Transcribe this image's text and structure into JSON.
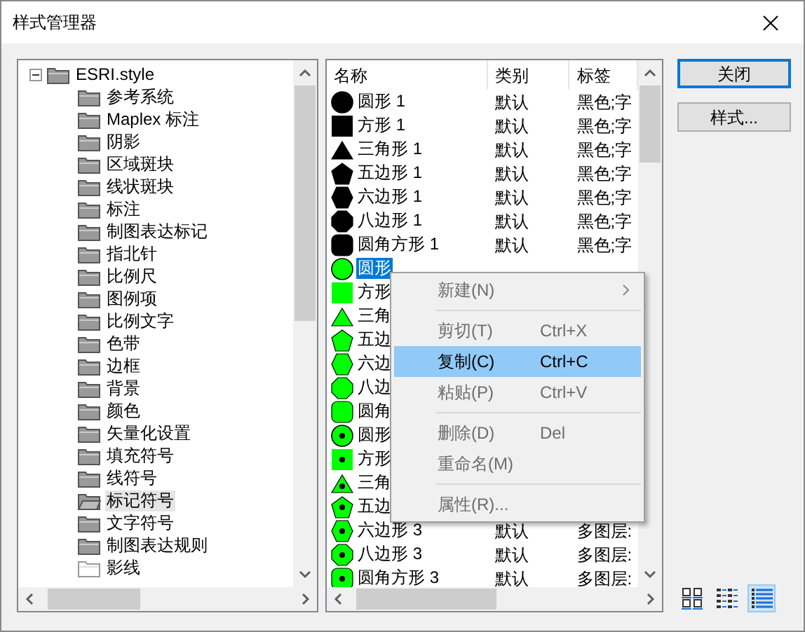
{
  "window": {
    "title": "样式管理器"
  },
  "tree": {
    "items": [
      {
        "label": "ESRI.style",
        "expanded": true,
        "children": [
          {
            "label": "参考系统",
            "selected": false,
            "empty": false
          },
          {
            "label": "Maplex 标注",
            "selected": false,
            "empty": false
          },
          {
            "label": "阴影",
            "selected": false,
            "empty": false
          },
          {
            "label": "区域斑块",
            "selected": false,
            "empty": false
          },
          {
            "label": "线状斑块",
            "selected": false,
            "empty": false
          },
          {
            "label": "标注",
            "selected": false,
            "empty": false
          },
          {
            "label": "制图表达标记",
            "selected": false,
            "empty": false
          },
          {
            "label": "指北针",
            "selected": false,
            "empty": false
          },
          {
            "label": "比例尺",
            "selected": false,
            "empty": false
          },
          {
            "label": "图例项",
            "selected": false,
            "empty": false
          },
          {
            "label": "比例文字",
            "selected": false,
            "empty": false
          },
          {
            "label": "色带",
            "selected": false,
            "empty": false
          },
          {
            "label": "边框",
            "selected": false,
            "empty": false
          },
          {
            "label": "背景",
            "selected": false,
            "empty": false
          },
          {
            "label": "颜色",
            "selected": false,
            "empty": false
          },
          {
            "label": "矢量化设置",
            "selected": false,
            "empty": false
          },
          {
            "label": "填充符号",
            "selected": false,
            "empty": false
          },
          {
            "label": "线符号",
            "selected": false,
            "empty": false
          },
          {
            "label": "标记符号",
            "selected": true,
            "empty": false
          },
          {
            "label": "文字符号",
            "selected": false,
            "empty": false
          },
          {
            "label": "制图表达规则",
            "selected": false,
            "empty": false
          },
          {
            "label": "影线",
            "selected": false,
            "empty": true
          }
        ]
      }
    ]
  },
  "table": {
    "columns": [
      "名称",
      "类别",
      "标签"
    ],
    "rows": [
      {
        "kind": "circle",
        "color": "#000000",
        "dot": false,
        "selected": false,
        "name": "圆形 1",
        "category": "默认",
        "tag": "黑色;字"
      },
      {
        "kind": "square",
        "color": "#000000",
        "dot": false,
        "selected": false,
        "name": "方形 1",
        "category": "默认",
        "tag": "黑色;字"
      },
      {
        "kind": "triangle",
        "color": "#000000",
        "dot": false,
        "selected": false,
        "name": "三角形 1",
        "category": "默认",
        "tag": "黑色;字"
      },
      {
        "kind": "pentagon",
        "color": "#000000",
        "dot": false,
        "selected": false,
        "name": "五边形 1",
        "category": "默认",
        "tag": "黑色;字"
      },
      {
        "kind": "hexagon",
        "color": "#000000",
        "dot": false,
        "selected": false,
        "name": "六边形 1",
        "category": "默认",
        "tag": "黑色;字"
      },
      {
        "kind": "octagon",
        "color": "#000000",
        "dot": false,
        "selected": false,
        "name": "八边形 1",
        "category": "默认",
        "tag": "黑色;字"
      },
      {
        "kind": "rounded",
        "color": "#000000",
        "dot": false,
        "selected": false,
        "name": "圆角方形 1",
        "category": "默认",
        "tag": "黑色;字"
      },
      {
        "kind": "circle",
        "color": "#00ff00",
        "dot": false,
        "selected": true,
        "name": "圆形"
      },
      {
        "kind": "square",
        "color": "#00ff00",
        "dot": false,
        "selected": false,
        "name": "方形"
      },
      {
        "kind": "triangle",
        "color": "#00ff00",
        "dot": false,
        "selected": false,
        "name": "三角"
      },
      {
        "kind": "pentagon",
        "color": "#00ff00",
        "dot": false,
        "selected": false,
        "name": "五边"
      },
      {
        "kind": "hexagon",
        "color": "#00ff00",
        "dot": false,
        "selected": false,
        "name": "六边"
      },
      {
        "kind": "octagon",
        "color": "#00ff00",
        "dot": false,
        "selected": false,
        "name": "八边"
      },
      {
        "kind": "rounded",
        "color": "#00ff00",
        "dot": false,
        "selected": false,
        "name": "圆角"
      },
      {
        "kind": "circle",
        "color": "#00ff00",
        "dot": true,
        "selected": false,
        "name": "圆形"
      },
      {
        "kind": "square",
        "color": "#00ff00",
        "dot": true,
        "selected": false,
        "name": "方形"
      },
      {
        "kind": "triangle",
        "color": "#00ff00",
        "dot": true,
        "selected": false,
        "name": "三角"
      },
      {
        "kind": "pentagon",
        "color": "#00ff00",
        "dot": true,
        "selected": false,
        "name": "五边"
      },
      {
        "kind": "hexagon",
        "color": "#00ff00",
        "dot": true,
        "selected": false,
        "name": "六边形 3",
        "category": "默认",
        "tag": "多图层:"
      },
      {
        "kind": "octagon",
        "color": "#00ff00",
        "dot": true,
        "selected": false,
        "name": "八边形 3",
        "category": "默认",
        "tag": "多图层:"
      },
      {
        "kind": "rounded",
        "color": "#00ff00",
        "dot": true,
        "selected": false,
        "name": "圆角方形 3",
        "category": "默认",
        "tag": "多图层:"
      }
    ]
  },
  "context_menu": {
    "items": [
      {
        "kind": "item",
        "label": "新建(N)",
        "disabled": true,
        "submenu": true,
        "selected": false
      },
      {
        "kind": "separator"
      },
      {
        "kind": "item",
        "label": "剪切(T)",
        "shortcut": "Ctrl+X",
        "disabled": true,
        "selected": false
      },
      {
        "kind": "item",
        "label": "复制(C)",
        "shortcut": "Ctrl+C",
        "disabled": false,
        "selected": true
      },
      {
        "kind": "item",
        "label": "粘贴(P)",
        "shortcut": "Ctrl+V",
        "disabled": true,
        "selected": false
      },
      {
        "kind": "separator"
      },
      {
        "kind": "item",
        "label": "删除(D)",
        "shortcut": "Del",
        "disabled": true,
        "selected": false
      },
      {
        "kind": "item",
        "label": "重命名(M)",
        "disabled": true,
        "selected": false
      },
      {
        "kind": "separator"
      },
      {
        "kind": "item",
        "label": "属性(R)...",
        "disabled": true,
        "selected": false
      }
    ]
  },
  "buttons": [
    {
      "label": "关闭",
      "default": true
    },
    {
      "label": "样式...",
      "default": false
    }
  ],
  "view_modes": [
    {
      "kind": "large-icons",
      "selected": false
    },
    {
      "kind": "small-icons",
      "selected": false
    },
    {
      "kind": "details",
      "selected": true
    }
  ]
}
